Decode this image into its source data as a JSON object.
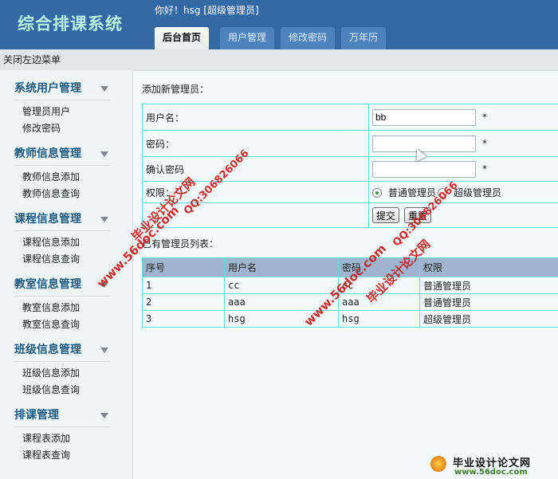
{
  "header": {
    "logo": "综合排课系统",
    "greeting": "你好！hsg [超级管理员]",
    "tabs": [
      "后台首页",
      "用户管理",
      "修改密码",
      "万年历"
    ]
  },
  "toggle_menu": "关闭左边菜单",
  "sidebar": [
    {
      "title": "系统用户管理",
      "items": [
        "管理员用户",
        "修改密码"
      ]
    },
    {
      "title": "教师信息管理",
      "items": [
        "教师信息添加",
        "教师信息查询"
      ]
    },
    {
      "title": "课程信息管理",
      "items": [
        "课程信息添加",
        "课程信息查询"
      ]
    },
    {
      "title": "教室信息管理",
      "items": [
        "教室信息添加",
        "教室信息查询"
      ]
    },
    {
      "title": "班级信息管理",
      "items": [
        "班级信息添加",
        "班级信息查询"
      ]
    },
    {
      "title": "排课管理",
      "items": [
        "课程表添加",
        "课程表查询"
      ]
    }
  ],
  "form": {
    "title": "添加新管理员：",
    "username_label": "用户名：",
    "username_value": "bb",
    "password_label": "密码：",
    "confirm_label": "确认密码",
    "role_label": "权限：",
    "required": "*",
    "role_normal": "普通管理员",
    "role_super": "超级管理员",
    "submit": "提交",
    "reset": "重置"
  },
  "list": {
    "title": "已有管理员列表：",
    "headers": [
      "序号",
      "用户名",
      "密码",
      "权限"
    ],
    "rows": [
      [
        "1",
        "cc",
        "cc",
        "普通管理员"
      ],
      [
        "2",
        "aaa",
        "aaa",
        "普通管理员"
      ],
      [
        "3",
        "hsg",
        "hsg",
        "超级管理员"
      ]
    ]
  },
  "watermark": {
    "site": "www.56doc.com",
    "name": "毕业设计论文网",
    "qq": "QQ:306826066"
  },
  "footer_logo": {
    "name": "毕业设计论文网",
    "url": "www.56doc.com"
  }
}
